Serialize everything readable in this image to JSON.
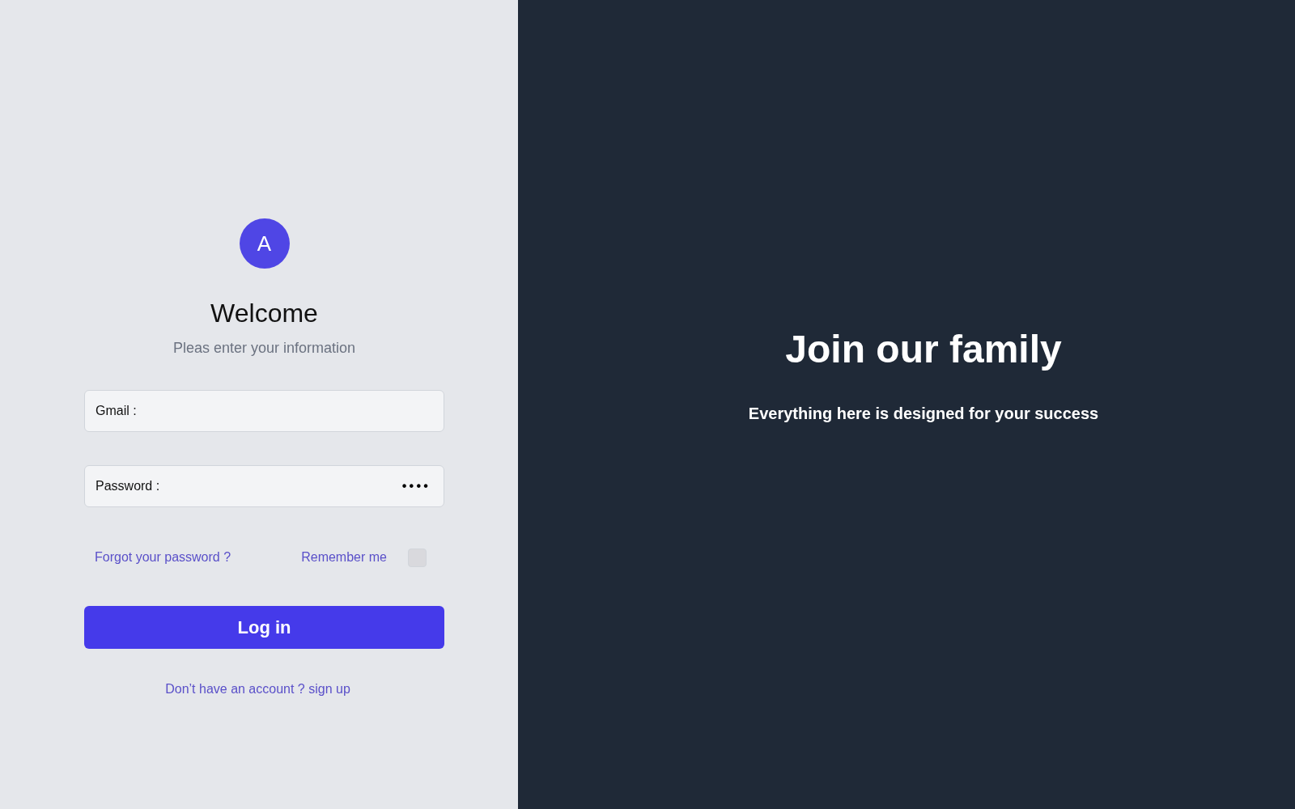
{
  "login": {
    "avatar": {
      "initial": "A"
    },
    "title": "Welcome",
    "subtitle": "Pleas enter your information",
    "fields": [
      {
        "label": "Gmail :"
      },
      {
        "label": "Password :",
        "value": "••••"
      }
    ],
    "forgot_link": "Forgot your password ?",
    "remember_me": {
      "label": "Remember me",
      "checked": false
    },
    "login_button": "Log in",
    "signup_link": "Don’t have an account ? sign up"
  },
  "promo": {
    "title": "Join our family",
    "subtitle": "Everything here is designed for your success"
  }
}
